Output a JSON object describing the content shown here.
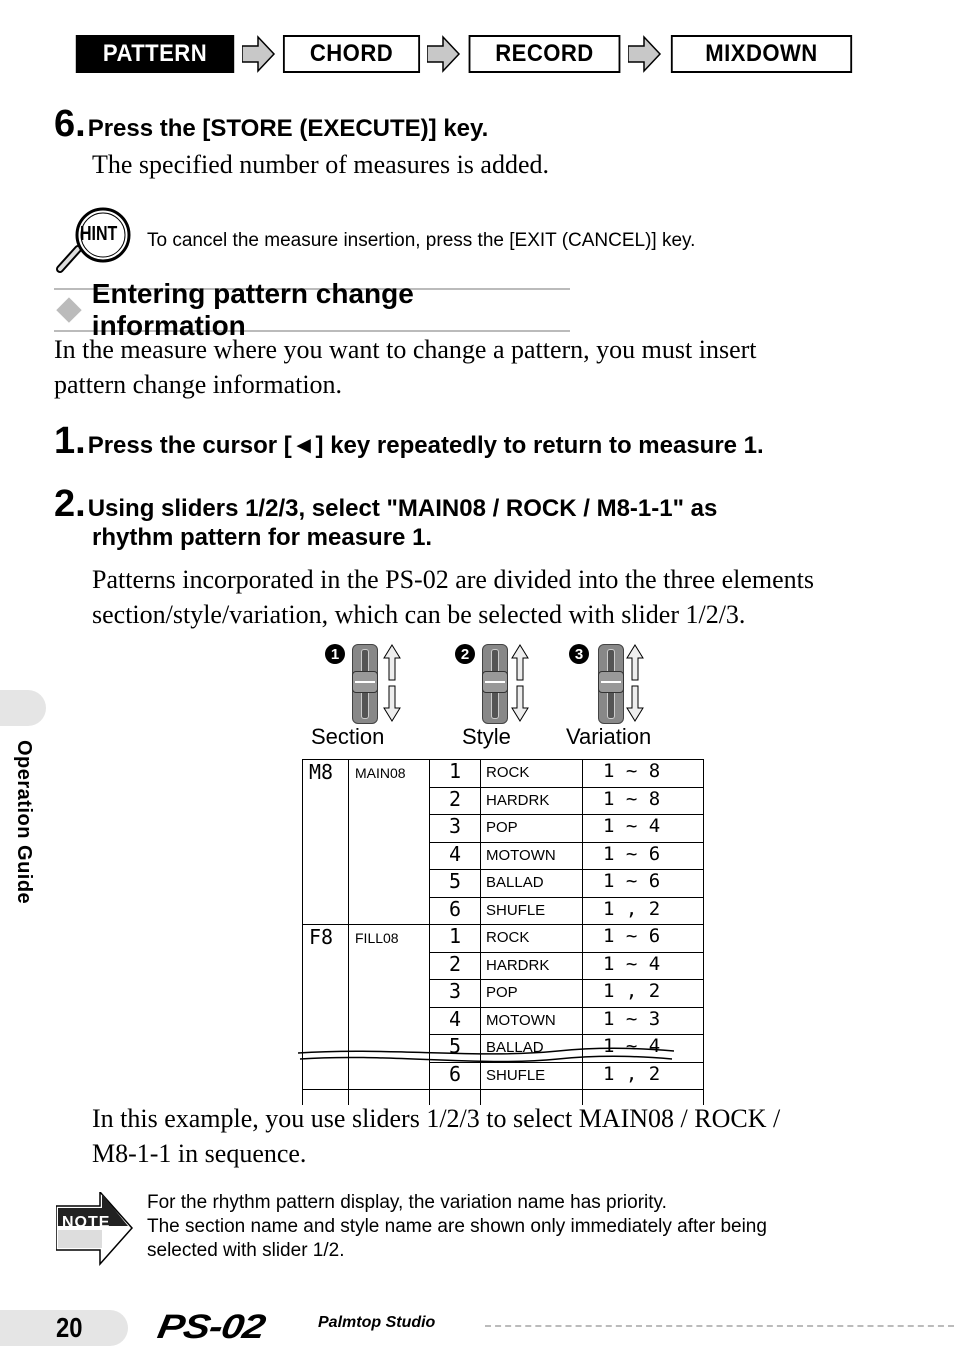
{
  "workflow": {
    "steps": [
      {
        "label": "PATTERN",
        "active": true
      },
      {
        "label": "CHORD",
        "active": false
      },
      {
        "label": "RECORD",
        "active": false
      },
      {
        "label": "MIXDOWN",
        "active": false
      }
    ]
  },
  "step6": {
    "number": "6.",
    "title": "Press the [STORE (EXECUTE)] key.",
    "body": "The specified number of measures is added."
  },
  "hint": {
    "icon_label": "HINT",
    "text": "To cancel the measure insertion, press the [EXIT (CANCEL)] key."
  },
  "section": {
    "title": "Entering pattern change information",
    "intro_line1": "In the measure where you want to change a pattern, you must insert",
    "intro_line2": "pattern change information."
  },
  "step1": {
    "number": "1.",
    "title": "Press the cursor [◄] key repeatedly to return to measure 1."
  },
  "step2": {
    "number": "2.",
    "title_line1": "Using sliders 1/2/3, select \"MAIN08 / ROCK / M8-1-1\" as",
    "title_line2": "rhythm pattern for measure 1.",
    "body_line1": "Patterns incorporated in the PS-02 are divided into the three elements",
    "body_line2": "section/style/variation, which can be selected with slider 1/2/3."
  },
  "sliders": [
    {
      "badge": "1",
      "label": "Section"
    },
    {
      "badge": "2",
      "label": "Style"
    },
    {
      "badge": "3",
      "label": "Variation"
    }
  ],
  "pattern_table": {
    "sections": [
      {
        "code": "M8",
        "name": "MAIN08",
        "styles": [
          {
            "num": "1",
            "name": "ROCK",
            "variations": "1 ~ 8"
          },
          {
            "num": "2",
            "name": "HARDRK",
            "variations": "1 ~ 8"
          },
          {
            "num": "3",
            "name": "POP",
            "variations": "1 ~ 4"
          },
          {
            "num": "4",
            "name": "MOTOWN",
            "variations": "1 ~ 6"
          },
          {
            "num": "5",
            "name": "BALLAD",
            "variations": "1 ~ 6"
          },
          {
            "num": "6",
            "name": "SHUFLE",
            "variations": "1 , 2"
          }
        ]
      },
      {
        "code": "F8",
        "name": "FILL08",
        "styles": [
          {
            "num": "1",
            "name": "ROCK",
            "variations": "1 ~ 6"
          },
          {
            "num": "2",
            "name": "HARDRK",
            "variations": "1 ~ 4"
          },
          {
            "num": "3",
            "name": "POP",
            "variations": "1 , 2"
          },
          {
            "num": "4",
            "name": "MOTOWN",
            "variations": "1 ~ 3"
          },
          {
            "num": "5",
            "name": "BALLAD",
            "variations": "1 ~ 4"
          },
          {
            "num": "6",
            "name": "SHUFLE",
            "variations": "1 , 2"
          }
        ]
      }
    ]
  },
  "example": {
    "line1": "In this example, you use sliders 1/2/3 to select MAIN08 / ROCK /",
    "line2": "M8-1-1 in sequence."
  },
  "note": {
    "icon_label": "NOTE",
    "line1": "For the rhythm pattern display, the variation name has priority.",
    "line2": "The section name and style name are shown only immediately after being",
    "line3": "selected with slider 1/2."
  },
  "side_tab": {
    "label": "Operation Guide"
  },
  "footer": {
    "page_number": "20",
    "logo": "PS-02",
    "logo_sub": "Palmtop Studio"
  }
}
